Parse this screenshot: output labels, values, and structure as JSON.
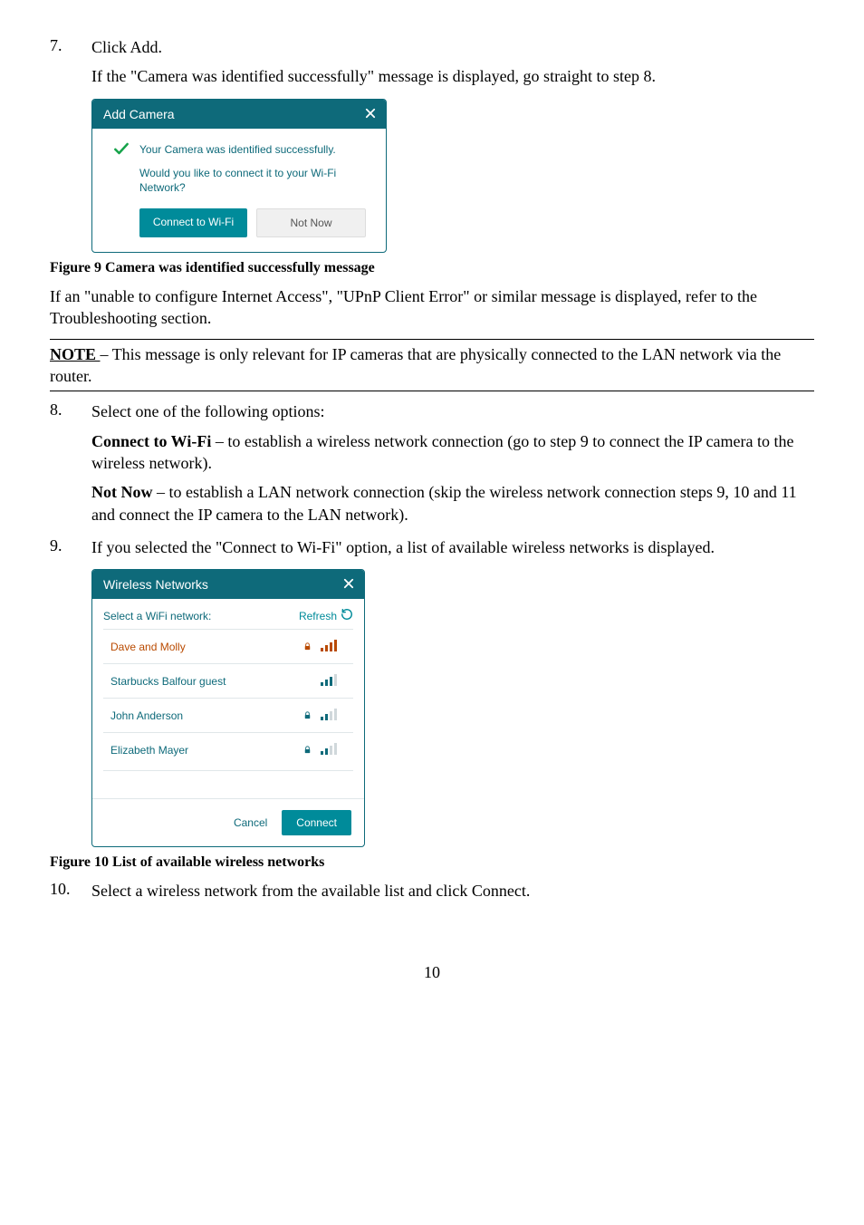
{
  "step7": {
    "num": "7.",
    "line1": "Click Add.",
    "line2": "If the \"Camera was identified successfully\" message is displayed, go straight to step 8."
  },
  "dlg1": {
    "title": "Add Camera",
    "msg": "Your Camera was identified successfully.",
    "q": "Would you like to connect it to your Wi-Fi Network?",
    "primary": "Connect to Wi-Fi",
    "secondary": "Not Now"
  },
  "fig9": "Figure 9 Camera was identified successfully message",
  "step7b": "If an \"unable to configure Internet Access\", \"UPnP Client Error\" or similar message is displayed, refer to the Troubleshooting section.",
  "note_label": "NOTE ",
  "note_body": "– This message is only relevant for IP cameras that are physically connected to the LAN network via the router.",
  "step8": {
    "num": "8.",
    "intro": "Select one of the following options:",
    "opt1_label": "Connect to Wi-Fi",
    "opt1_body": " – to establish a wireless network connection (go to step 9 to connect the IP camera to the wireless network).",
    "opt2_label": "Not Now",
    "opt2_body": " – to establish a LAN network connection (skip the wireless network connection steps 9, 10 and 11 and connect the IP camera to the LAN network)."
  },
  "step9": {
    "num": "9.",
    "body": "If you selected the \"Connect to Wi-Fi\" option, a list of available wireless networks is displayed."
  },
  "dlg2": {
    "title": "Wireless Networks",
    "select": "Select a WiFi network:",
    "refresh": "Refresh",
    "cancel": "Cancel",
    "connect": "Connect",
    "items": [
      {
        "name": "Dave and Molly",
        "locked": true,
        "bars": 4,
        "selected": true
      },
      {
        "name": "Starbucks Balfour guest",
        "locked": false,
        "bars": 3,
        "selected": false
      },
      {
        "name": "John Anderson",
        "locked": true,
        "bars": 2,
        "selected": false
      },
      {
        "name": "Elizabeth Mayer",
        "locked": true,
        "bars": 2,
        "selected": false
      }
    ]
  },
  "fig10": "Figure 10 List of available wireless networks",
  "step10": {
    "num": "10.",
    "body": "Select a wireless network from the available list and click Connect."
  },
  "page": "10"
}
